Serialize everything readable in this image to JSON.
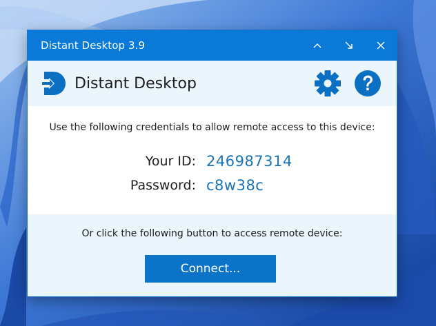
{
  "window": {
    "title": "Distant Desktop 3.9",
    "controls": {
      "collapse_icon": "chevron-up-icon",
      "minimize_icon": "minimize-arrow-icon",
      "close_icon": "close-icon"
    }
  },
  "header": {
    "app_name": "Distant Desktop",
    "logo_icon": "distant-desktop-logo",
    "settings_icon": "gear-icon",
    "help_icon": "question-circle-icon"
  },
  "credentials": {
    "intro": "Use the following credentials to allow remote access to this device:",
    "id_label": "Your ID:",
    "id_value": "246987314",
    "password_label": "Password:",
    "password_value": "c8w38c"
  },
  "connect": {
    "intro": "Or click the following button to access remote device:",
    "button_label": "Connect..."
  },
  "colors": {
    "titlebar": "#0a79d8",
    "accent": "#1a73b5",
    "header_bg": "#eaf6fc",
    "button": "#0b74c9"
  }
}
